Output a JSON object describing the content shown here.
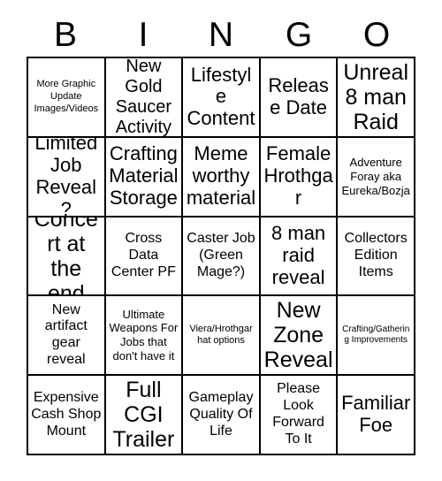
{
  "card": {
    "title": "BINGO",
    "header_letters": [
      "B",
      "I",
      "N",
      "G",
      "O"
    ],
    "grid_size": "5x5",
    "colors": {
      "background": "#ffffff",
      "text": "#000000",
      "border": "#000000"
    },
    "rows": [
      [
        {
          "text": "More Graphic Update Images/Videos",
          "size": "xs"
        },
        {
          "text": "New Gold Saucer Activity",
          "size": "lg"
        },
        {
          "text": "Lifestyle Content",
          "size": "xl"
        },
        {
          "text": "Release Date",
          "size": "xl"
        },
        {
          "text": "Unreal 8 man Raid",
          "size": "xxl"
        }
      ],
      [
        {
          "text": "Limited Job Reveal?",
          "size": "xl"
        },
        {
          "text": "Crafting Material Storage",
          "size": "xl"
        },
        {
          "text": "Meme worthy material",
          "size": "xl"
        },
        {
          "text": "Female Hrothgar",
          "size": "xl"
        },
        {
          "text": "Adventure Foray aka Eureka/Bozja",
          "size": "sm"
        }
      ],
      [
        {
          "text": "Concert at the end",
          "size": "xxl"
        },
        {
          "text": "Cross Data Center PF",
          "size": "md"
        },
        {
          "text": "Caster Job (Green Mage?)",
          "size": "md"
        },
        {
          "text": "8 man raid reveal",
          "size": "xl"
        },
        {
          "text": "Collectors Edition Items",
          "size": "md"
        }
      ],
      [
        {
          "text": "New artifact gear reveal",
          "size": "md"
        },
        {
          "text": "Ultimate Weapons For Jobs that don't have it",
          "size": "sm"
        },
        {
          "text": "Viera/Hrothgar hat options",
          "size": "xs"
        },
        {
          "text": "New Zone Reveal",
          "size": "xxl"
        },
        {
          "text": "Crafting/Gathering Improvements",
          "size": "xxs"
        }
      ],
      [
        {
          "text": "Expensive Cash Shop Mount",
          "size": "md"
        },
        {
          "text": "Full CGI Trailer",
          "size": "xxl"
        },
        {
          "text": "Gameplay Quality Of Life",
          "size": "md"
        },
        {
          "text": "Please Look Forward To It",
          "size": "md"
        },
        {
          "text": "Familiar Foe",
          "size": "xl"
        }
      ]
    ]
  }
}
